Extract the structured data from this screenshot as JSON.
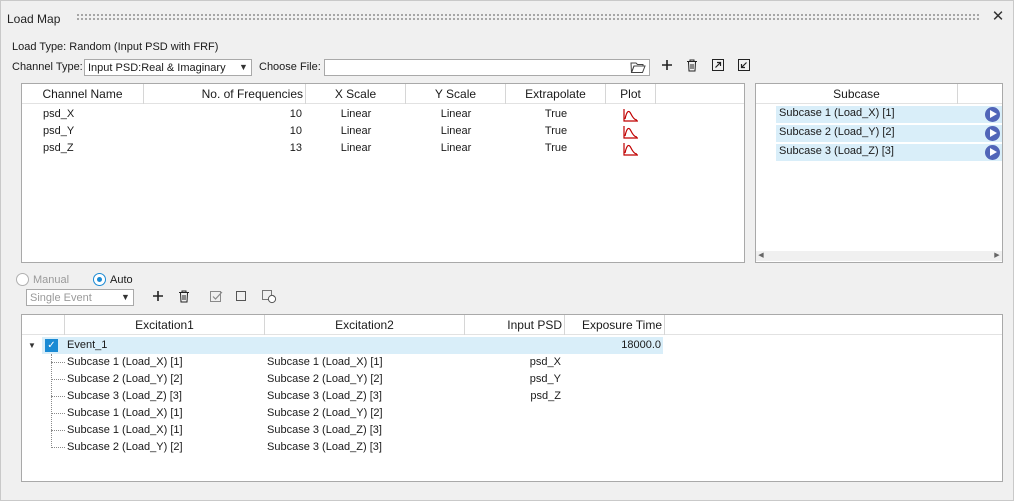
{
  "window": {
    "title": "Load Map",
    "close_glyph": "✕"
  },
  "load_type": "Load Type: Random (Input PSD with FRF)",
  "channel_type": {
    "label": "Channel Type:",
    "value": "Input PSD:Real & Imaginary"
  },
  "choose_file": {
    "label": "Choose File:",
    "value": ""
  },
  "toolbar_icons": [
    "folder-icon",
    "add-icon",
    "delete-icon",
    "export-icon",
    "import-icon"
  ],
  "channel_table": {
    "headers": [
      "Channel Name",
      "No. of Frequencies",
      "X Scale",
      "Y Scale",
      "Extrapolate",
      "Plot"
    ],
    "rows": [
      {
        "name": "psd_X",
        "freq": "10",
        "xscale": "Linear",
        "yscale": "Linear",
        "extrap": "True"
      },
      {
        "name": "psd_Y",
        "freq": "10",
        "xscale": "Linear",
        "yscale": "Linear",
        "extrap": "True"
      },
      {
        "name": "psd_Z",
        "freq": "13",
        "xscale": "Linear",
        "yscale": "Linear",
        "extrap": "True"
      }
    ]
  },
  "subcase_panel": {
    "header": "Subcase",
    "items": [
      "Subcase 1 (Load_X) [1]",
      "Subcase 2 (Load_Y) [2]",
      "Subcase 3 (Load_Z) [3]"
    ]
  },
  "mode": {
    "manual": "Manual",
    "auto": "Auto",
    "selected": "auto"
  },
  "event_type": {
    "value": "Single Event"
  },
  "event_table": {
    "headers": [
      "Excitation1",
      "Excitation2",
      "Input PSD",
      "Exposure Time"
    ],
    "event": {
      "name": "Event_1",
      "exposure": "18000.0",
      "checked": true
    },
    "rows": [
      {
        "e1": "Subcase 1 (Load_X) [1]",
        "e2": "Subcase 1 (Load_X) [1]",
        "psd": "psd_X"
      },
      {
        "e1": "Subcase 2 (Load_Y) [2]",
        "e2": "Subcase 2 (Load_Y) [2]",
        "psd": "psd_Y"
      },
      {
        "e1": "Subcase 3 (Load_Z) [3]",
        "e2": "Subcase 3 (Load_Z) [3]",
        "psd": "psd_Z"
      },
      {
        "e1": "Subcase 1 (Load_X) [1]",
        "e2": "Subcase 2 (Load_Y) [2]",
        "psd": ""
      },
      {
        "e1": "Subcase 1 (Load_X) [1]",
        "e2": "Subcase 3 (Load_Z) [3]",
        "psd": ""
      },
      {
        "e1": "Subcase 2 (Load_Y) [2]",
        "e2": "Subcase 3 (Load_Z) [3]",
        "psd": ""
      }
    ]
  },
  "colors": {
    "accent": "#1a8ad4",
    "selection": "#d9eef9",
    "play": "#5165b8",
    "plot": "#c00000"
  }
}
